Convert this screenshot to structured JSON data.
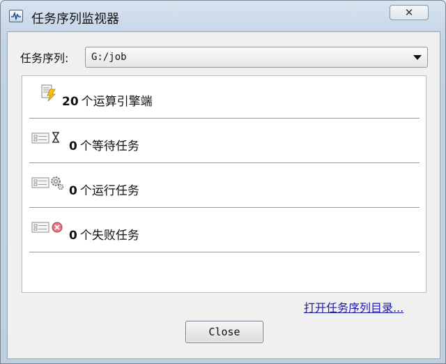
{
  "window": {
    "title": "任务序列监视器",
    "icon": "monitor-app-icon",
    "close_glyph": "✕"
  },
  "queue": {
    "label": "任务序列:",
    "selected_value": "G:/job"
  },
  "status": [
    {
      "count": "20",
      "text": "个运算引擎端",
      "icon": "engine-icon"
    },
    {
      "count": "0",
      "text": "个等待任务",
      "icon": "waiting-hourglass-icon"
    },
    {
      "count": "0",
      "text": "个运行任务",
      "icon": "running-gear-icon"
    },
    {
      "count": "0",
      "text": "个失败任务",
      "icon": "failed-error-icon"
    }
  ],
  "actions": {
    "open_folder_link": "打开任务序列目录...",
    "close_button": "Close"
  }
}
